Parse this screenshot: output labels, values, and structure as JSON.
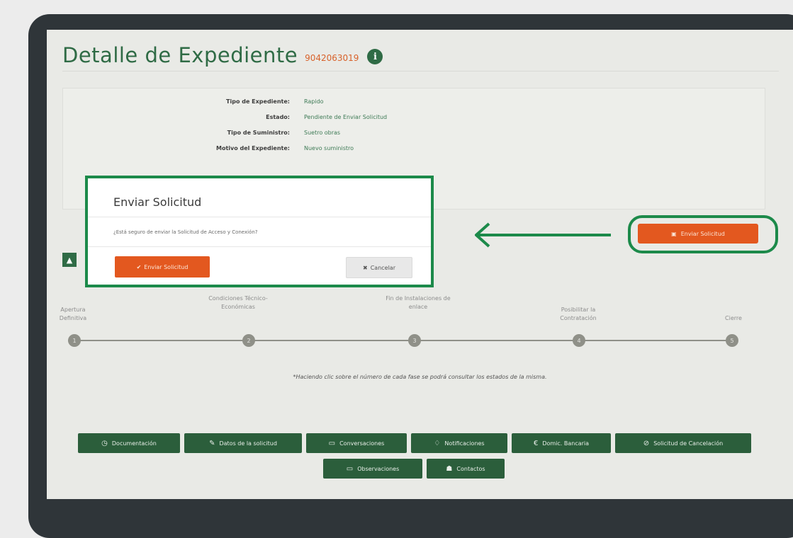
{
  "header": {
    "title": "Detalle de Expediente",
    "expediente_number": "9042063019",
    "info_icon_glyph": "i"
  },
  "info": {
    "rows": [
      {
        "label": "Tipo de Expediente:",
        "value": "Rapido"
      },
      {
        "label": "Estado:",
        "value": "Pendiente de Enviar Solicitud"
      },
      {
        "label": "Tipo de Suministro:",
        "value": "Suetro obras"
      },
      {
        "label": "Motivo del Expediente:",
        "value": "Nuevo suministro"
      }
    ]
  },
  "modal": {
    "title": "Enviar Solicitud",
    "question": "¿Está seguro de enviar la Solicitud de Acceso y Conexión?",
    "send_label": "Enviar Solicitud",
    "send_icon": "check-icon",
    "cancel_label": "Cancelar",
    "cancel_icon": "x-icon"
  },
  "actions": {
    "send_request_label": "Enviar Solicitud",
    "send_request_icon": "file-icon"
  },
  "phases": {
    "items": [
      {
        "label": "Apertura Definitiva",
        "number": "1"
      },
      {
        "label": "Condiciones Técnico-Económicas",
        "number": "2"
      },
      {
        "label": "Fin de Instalaciones de enlace",
        "number": "3"
      },
      {
        "label": "Posibilitar la Contratación",
        "number": "4"
      },
      {
        "label": "Cierre",
        "number": "5"
      }
    ],
    "note": "*Haciendo clic sobre el número de cada fase se podrá consultar los estados de la misma."
  },
  "bottom_buttons": [
    {
      "label": "Documentación",
      "icon": "clock-icon"
    },
    {
      "label": "Datos de la solicitud",
      "icon": "edit-icon"
    },
    {
      "label": "Conversaciones",
      "icon": "chat-icon"
    },
    {
      "label": "Notificaciones",
      "icon": "bell-icon"
    },
    {
      "label": "Domic. Bancaria",
      "icon": "euro-icon"
    },
    {
      "label": "Solicitud de Cancelación",
      "icon": "ban-icon"
    },
    {
      "label": "Observaciones",
      "icon": "comments-icon"
    },
    {
      "label": "Contactos",
      "icon": "contacts-icon"
    }
  ],
  "colors": {
    "brand_green": "#2f6b45",
    "accent_orange": "#e3581f",
    "highlight_green": "#1c8a4a"
  }
}
